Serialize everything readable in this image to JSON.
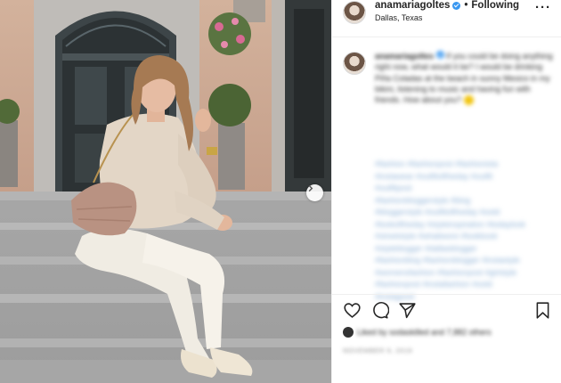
{
  "header": {
    "username": "anamariagoltes",
    "separator": "•",
    "follow_status": "Following",
    "location": "Dallas, Texas",
    "more_icon": "more-horizontal-icon"
  },
  "caption": {
    "author": "anamariagoltes",
    "text": "If you could be doing anything right now, what would it be? I would be drinking Piña Coladas at the beach in sunny Mexico in my bikini, listening to music and having fun with friends. How about you?",
    "emoji": "smiling-face-emoji"
  },
  "hashtags": [
    "#fashion #fashionpost #fashionista",
    "#instawear #outfitoftheday #outfit",
    "#outfitpost",
    "#fashionbloggerstyle #blog",
    "#bloggerstyle #outfitoftheday #ootd",
    "#lookoftheday #styleinspiration #todaylook",
    "#streetstyle #whatiwore #lookbook",
    "#styleblogger #dallasblogger",
    "#fashionblog #fashionblogger #instastyle",
    "#womensfashion #fashionpost #girlstyle",
    "#fashionpost #instafashion #ootd",
    "#instagood"
  ],
  "likes": {
    "text": "Liked by sodaskilled and 7,882 others"
  },
  "date": "NOVEMBER 9, 2019",
  "colors": {
    "accent": "#3897f0",
    "hashtag": "#8bb0d6",
    "border": "#efefef"
  },
  "icons": {
    "like": "heart-icon",
    "comment": "comment-icon",
    "share": "send-icon",
    "save": "bookmark-icon",
    "next": "chevron-right-icon",
    "verified": "verified-badge-icon"
  }
}
